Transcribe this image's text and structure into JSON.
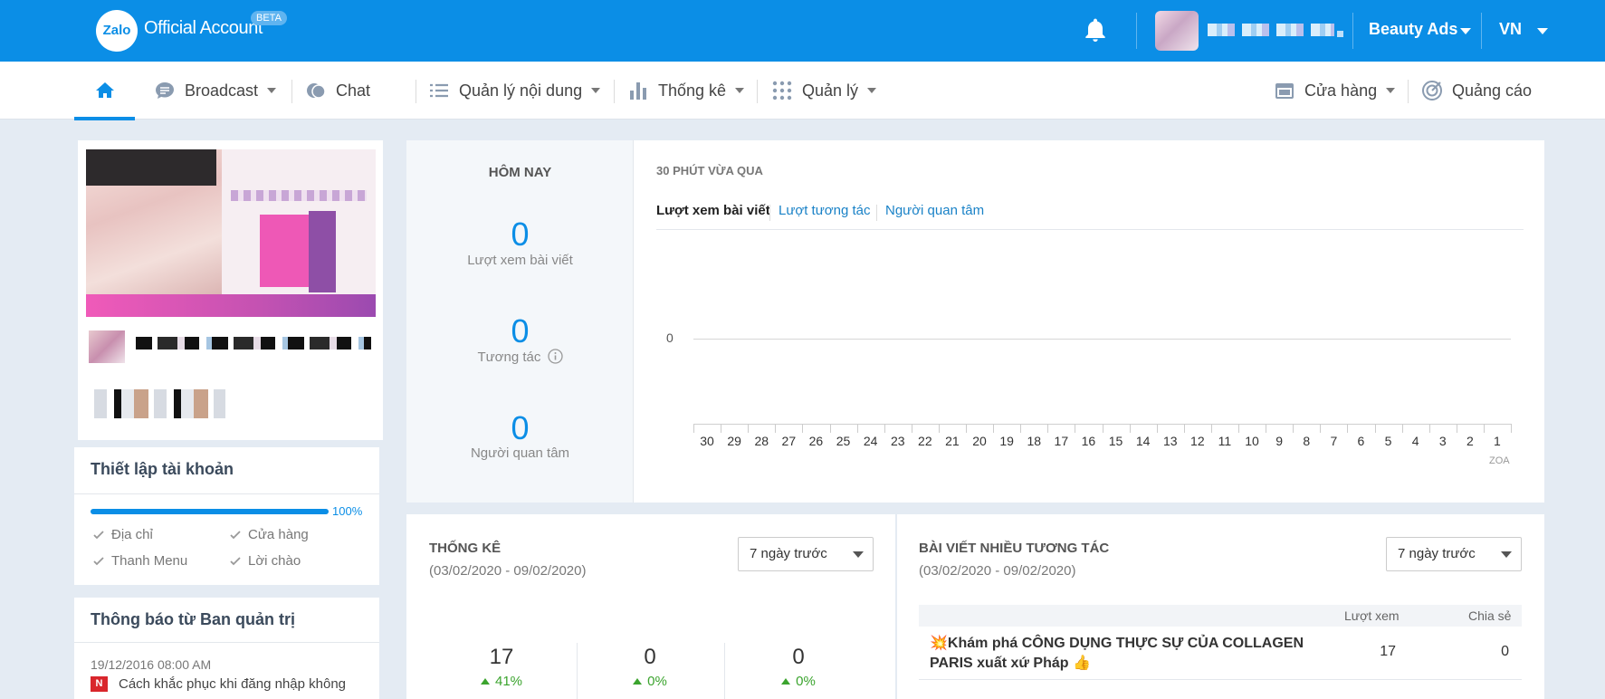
{
  "header": {
    "logo_mark": "Zalo",
    "logo_text": "Official Account",
    "beta_badge": "BETA",
    "account_name": "Beauty Ads",
    "language": "VN",
    "colors": {
      "brand": "#0b8ee6",
      "text": "#ffffff"
    }
  },
  "nav": {
    "home_icon": "home-icon",
    "broadcast": "Broadcast",
    "chat": "Chat",
    "content": "Quản lý nội dung",
    "stats": "Thống kê",
    "manage": "Quản lý",
    "store": "Cửa hàng",
    "ads": "Quảng cáo"
  },
  "account_setup": {
    "title": "Thiết lập tài khoản",
    "progress_percent": 100,
    "progress_label": "100%",
    "items": [
      "Địa chỉ",
      "Cửa hàng",
      "Thanh Menu",
      "Lời chào"
    ]
  },
  "admin_notice": {
    "title": "Thông báo từ Ban quản trị",
    "date": "19/12/2016 08:00 AM",
    "badge": "N",
    "message": "Cách khắc phục khi đăng nhập không"
  },
  "today": {
    "title": "HÔM NAY",
    "metrics": [
      {
        "value": "0",
        "label": "Lượt xem bài viết"
      },
      {
        "value": "0",
        "label": "Tương tác"
      },
      {
        "value": "0",
        "label": "Người quan tâm"
      }
    ]
  },
  "recent": {
    "title": "30 PHÚT VỪA QUA",
    "tabs": [
      "Lượt xem bài viết",
      "Lượt tương tác",
      "Người quan tâm"
    ],
    "y_label": "0",
    "x_ticks": [
      "30",
      "29",
      "28",
      "27",
      "26",
      "25",
      "24",
      "23",
      "22",
      "21",
      "20",
      "19",
      "18",
      "17",
      "16",
      "15",
      "14",
      "13",
      "12",
      "11",
      "10",
      "9",
      "8",
      "7",
      "6",
      "5",
      "4",
      "3",
      "2",
      "1"
    ],
    "watermark": "ZOA"
  },
  "stats": {
    "title": "THỐNG KÊ",
    "range": "(03/02/2020 - 09/02/2020)",
    "select_value": "7 ngày trước",
    "items": [
      {
        "value": "17",
        "change": "41%"
      },
      {
        "value": "0",
        "change": "0%"
      },
      {
        "value": "0",
        "change": "0%"
      }
    ]
  },
  "top_posts": {
    "title": "BÀI VIẾT NHIỀU TƯƠNG TÁC",
    "range": "(03/02/2020 - 09/02/2020)",
    "select_value": "7 ngày trước",
    "col_views": "Lượt xem",
    "col_shares": "Chia sẻ",
    "rows": [
      {
        "title_line1": "💥Khám phá CÔNG DỤNG THỰC SỰ CỦA COLLAGEN",
        "title_line2": "PARIS xuất xứ Pháp 👍",
        "views": "17",
        "shares": "0"
      }
    ]
  }
}
